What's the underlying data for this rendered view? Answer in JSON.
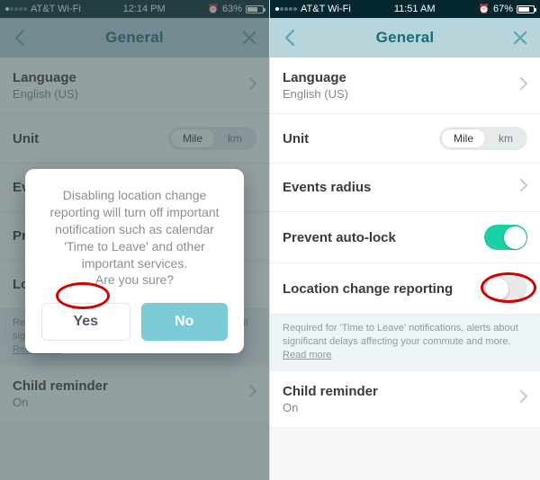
{
  "left": {
    "status": {
      "carrier": "AT&T Wi-Fi",
      "time": "12:14 PM",
      "battery_pct": "63%",
      "battery_fill": 63,
      "dots_on": 1
    },
    "header": {
      "title": "General"
    },
    "rows": {
      "language": {
        "label": "Language",
        "value": "English (US)"
      },
      "unit": {
        "label": "Unit",
        "seg_mile": "Mile",
        "seg_km": "km"
      },
      "events_radius": {
        "label": "Ev"
      },
      "prevent_autolock": {
        "label": "Pr"
      },
      "location_reporting": {
        "label": "Lo"
      },
      "child_reminder": {
        "label": "Child reminder",
        "value": "On"
      }
    },
    "footnote": {
      "text": "Required for 'Time to Leave' notifications, alerts about significant delays affecting your commute and more.",
      "readmore": "Read more"
    },
    "dialog": {
      "msg_l1": "Disabling location change",
      "msg_l2": "reporting will turn off important",
      "msg_l3": "notification such as calendar",
      "msg_l4": "'Time to Leave' and other",
      "msg_l5": "important services.",
      "msg_l6": "Are you sure?",
      "yes": "Yes",
      "no": "No"
    }
  },
  "right": {
    "status": {
      "carrier": "AT&T Wi-Fi",
      "time": "11:51 AM",
      "battery_pct": "67%",
      "battery_fill": 67,
      "dots_on": 1
    },
    "header": {
      "title": "General"
    },
    "rows": {
      "language": {
        "label": "Language",
        "value": "English (US)"
      },
      "unit": {
        "label": "Unit",
        "seg_mile": "Mile",
        "seg_km": "km"
      },
      "events_radius": {
        "label": "Events radius"
      },
      "prevent_autolock": {
        "label": "Prevent auto-lock"
      },
      "location_reporting": {
        "label": "Location change reporting"
      },
      "child_reminder": {
        "label": "Child reminder",
        "value": "On"
      }
    },
    "footnote": {
      "text": "Required for 'Time to Leave' notifications, alerts about significant delays affecting your commute and more.",
      "readmore": "Read more"
    }
  }
}
